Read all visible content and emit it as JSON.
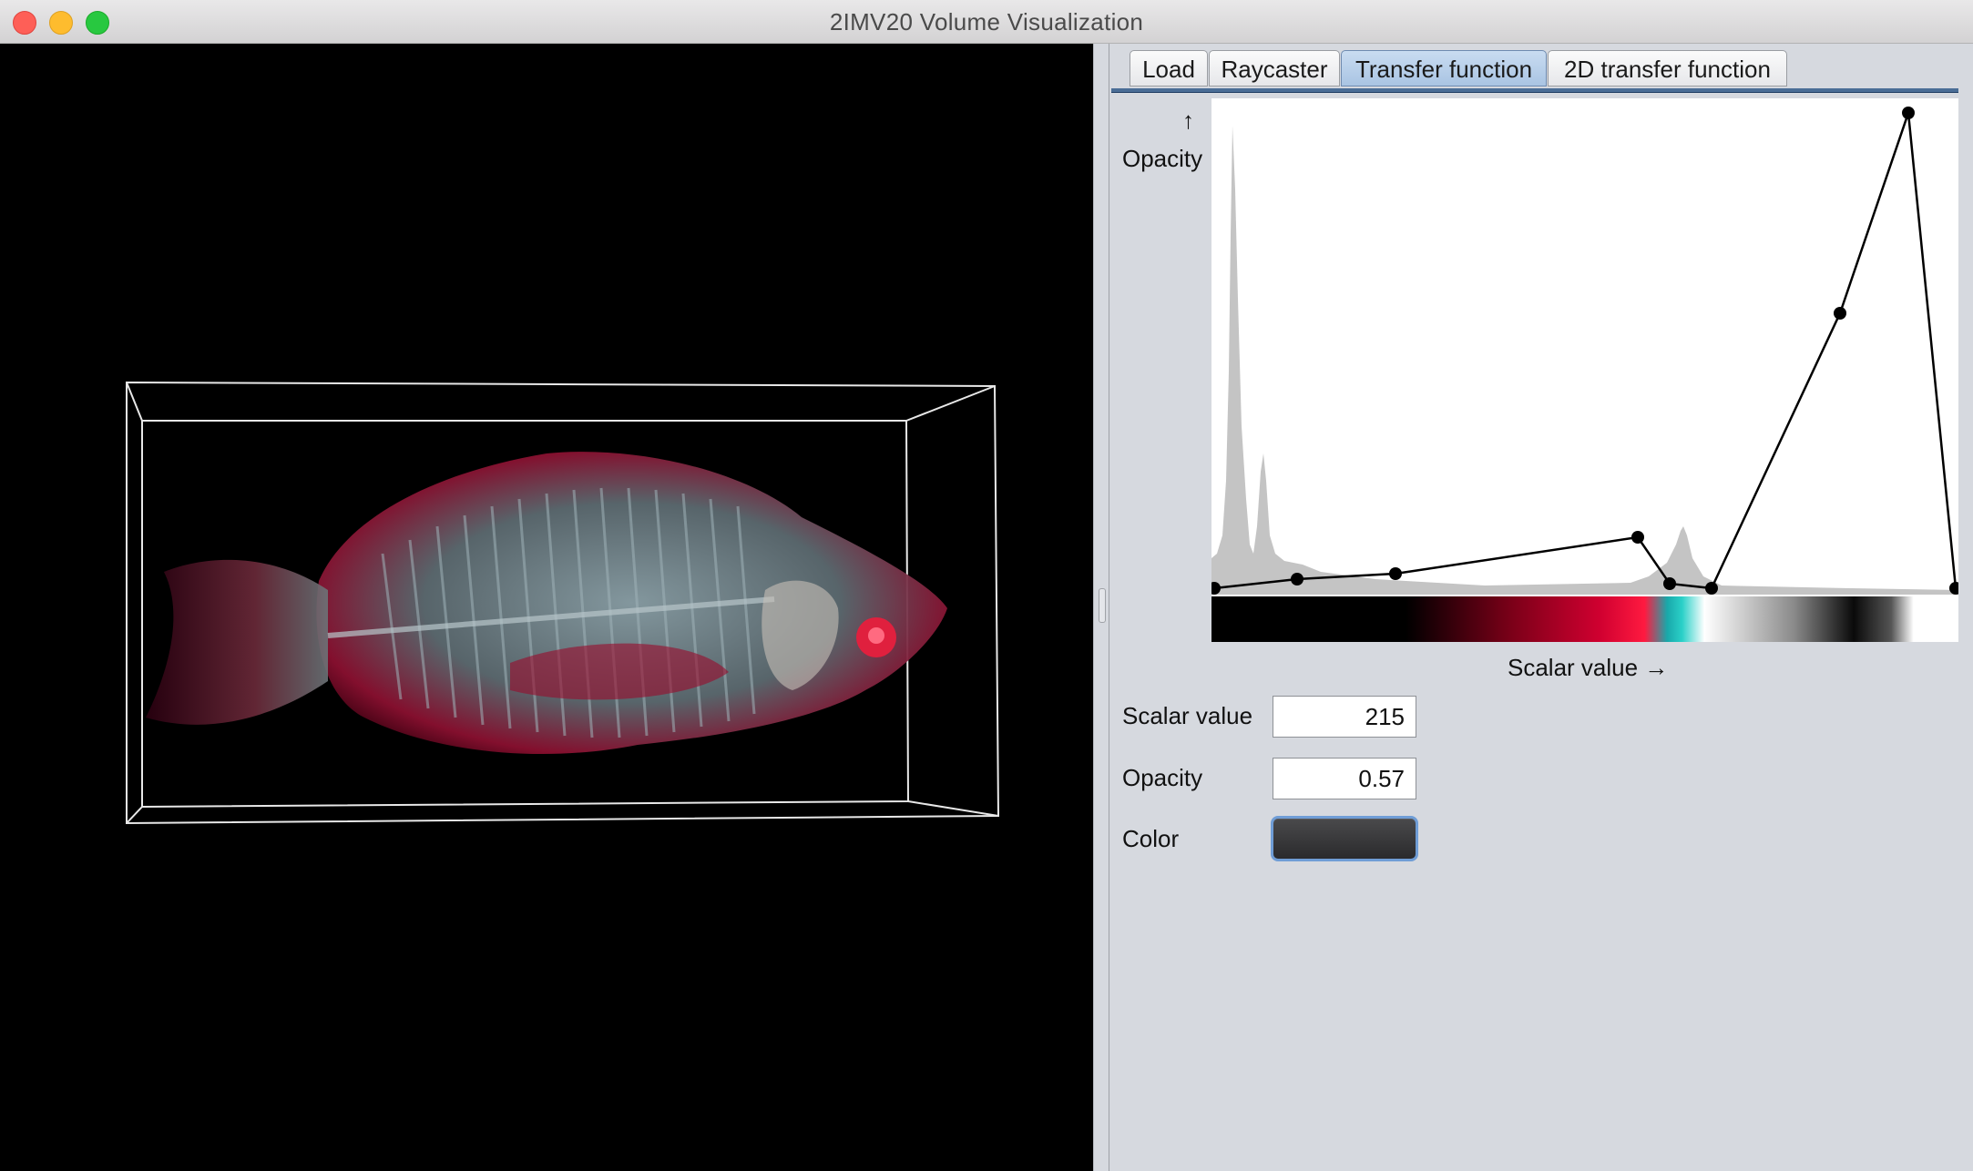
{
  "window": {
    "title": "2IMV20 Volume Visualization"
  },
  "tabs": [
    {
      "label": "Load",
      "active": false
    },
    {
      "label": "Raycaster",
      "active": false
    },
    {
      "label": "Transfer function",
      "active": true
    },
    {
      "label": "2D transfer function",
      "active": false
    }
  ],
  "transfer_function": {
    "y_arrow": "↑",
    "y_label": "Opacity",
    "x_label": "Scalar value →",
    "control_points_note": "opacity curve with control points over grey histogram",
    "gradient_colors": [
      "#000000",
      "#000000",
      "#c00028",
      "#ff1a40",
      "#19b4b4",
      "#ffffff",
      "#000000",
      "#ffffff"
    ]
  },
  "form": {
    "scalar_value_label": "Scalar value",
    "scalar_value": "215",
    "opacity_label": "Opacity",
    "opacity_value": "0.57",
    "color_label": "Color",
    "color_value": "#2e2e30"
  }
}
